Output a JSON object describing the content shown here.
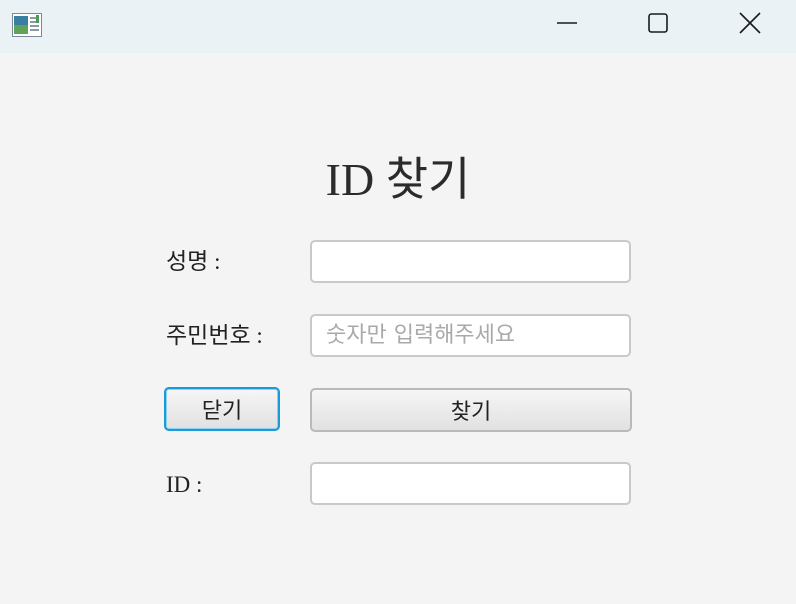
{
  "window": {
    "icon": "java-app-icon",
    "controls": {
      "minimize_icon": "minimize-icon",
      "maximize_icon": "maximize-icon",
      "close_icon": "close-icon"
    }
  },
  "form": {
    "title": "ID 찾기",
    "name_label": "성명 :",
    "name_value": "",
    "rrn_label": "주민번호 :",
    "rrn_value": "",
    "rrn_placeholder": "숫자만 입력해주세요",
    "close_button": "닫기",
    "find_button": "찾기",
    "id_label": "ID :",
    "id_value": ""
  },
  "colors": {
    "focus_border": "#1a9ad6",
    "titlebar": "#eaf2f6",
    "background": "#f4f4f4"
  }
}
